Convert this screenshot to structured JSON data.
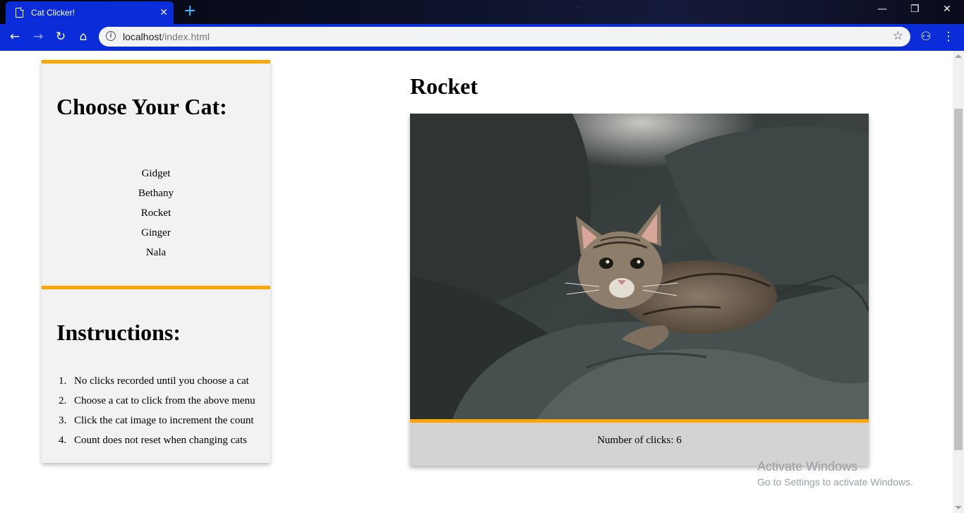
{
  "browser": {
    "tab_title": "Cat Clicker!",
    "tab_close": "✕",
    "new_tab": "+",
    "url_host": "localhost",
    "url_path": "/index.html",
    "info_glyph": "i",
    "star_glyph": "☆",
    "buttons": {
      "back": "←",
      "forward": "→",
      "reload": "↻",
      "home": "⌂",
      "extension": "⚇",
      "menu": "⋮",
      "minimize": "—",
      "restore": "❐",
      "close": "✕"
    }
  },
  "menu": {
    "heading": "Choose Your Cat:",
    "cats": [
      "Gidget",
      "Bethany",
      "Rocket",
      "Ginger",
      "Nala"
    ]
  },
  "instructions": {
    "heading": "Instructions:",
    "items": [
      {
        "num": "1.",
        "text": "No clicks recorded until you choose a cat"
      },
      {
        "num": "2.",
        "text": "Choose a cat to click from the above menu"
      },
      {
        "num": "3.",
        "text": "Click the cat image to increment the count"
      },
      {
        "num": "4.",
        "text": "Count does not reset when changing cats"
      }
    ]
  },
  "selected_cat": {
    "name": "Rocket",
    "clicks_text": "Number of clicks: 6",
    "clicks": 6
  },
  "watermark": {
    "line1": "Activate Windows",
    "line2": "Go to Settings to activate Windows."
  },
  "colors": {
    "accent": "#ffa500",
    "chrome_blue": "#0a2cd9",
    "panel_bg": "#f2f2f2",
    "click_bar_bg": "#d3d3d3"
  }
}
